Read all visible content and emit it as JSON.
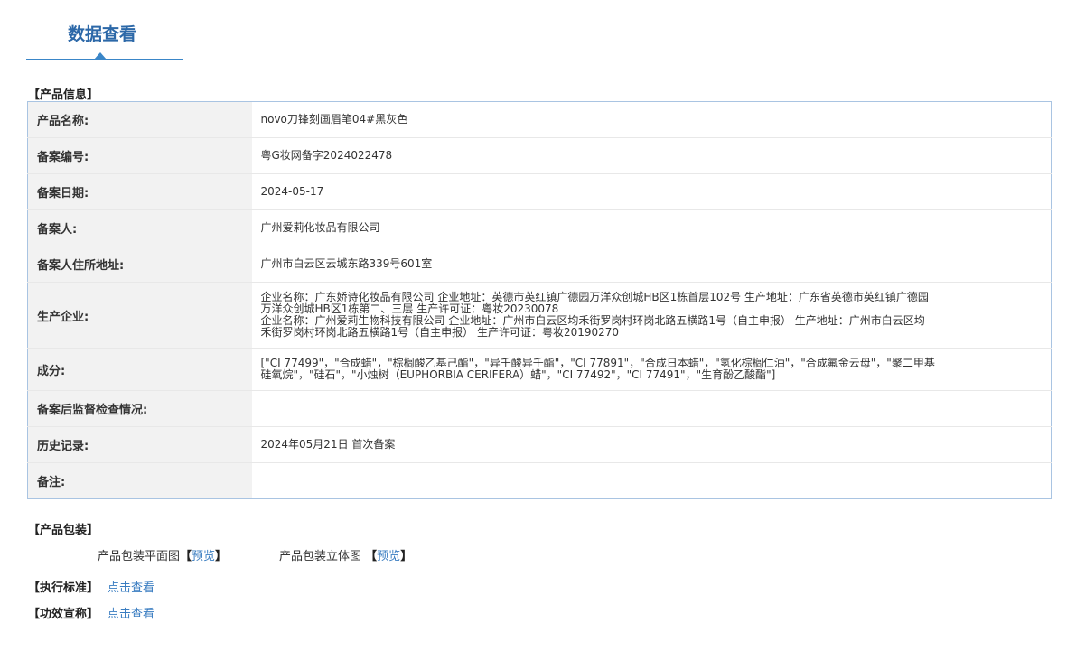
{
  "header": {
    "title": "数据查看"
  },
  "product_info": {
    "section_title": "【产品信息】",
    "rows": [
      {
        "label": "产品名称:",
        "value": "novo刀锋刻画眉笔04#黑灰色"
      },
      {
        "label": "备案编号:",
        "value": "粤G妆网备字2024022478"
      },
      {
        "label": "备案日期:",
        "value": "2024-05-17"
      },
      {
        "label": "备案人:",
        "value": "广州爱莉化妆品有限公司"
      },
      {
        "label": "备案人住所地址:",
        "value": "广州市白云区云城东路339号601室"
      },
      {
        "label": "生产企业:",
        "lines": [
          "企业名称：广东娇诗化妆品有限公司 企业地址：英德市英红镇广德园万洋众创城HB区1栋首层102号 生产地址：广东省英德市英红镇广德园",
          "万洋众创城HB区1栋第二、三层 生产许可证：粤妆20230078",
          "企业名称：广州爱莉生物科技有限公司 企业地址：广州市白云区均禾街罗岗村环岗北路五横路1号（自主申报） 生产地址：广州市白云区均",
          "禾街罗岗村环岗北路五横路1号（自主申报） 生产许可证：粤妆20190270"
        ]
      },
      {
        "label": "成分:",
        "lines": [
          "[\"CI 77499\"，\"合成蜡\"，\"棕榈酸乙基己酯\"，\"异壬酸异壬酯\"，\"CI 77891\"，\"合成日本蜡\"，\"氢化棕榈仁油\"，\"合成氟金云母\"，\"聚二甲基",
          "硅氧烷\"，\"硅石\"，\"小烛树（EUPHORBIA CERIFERA）蜡\"，\"CI 77492\"，\"CI 77491\"，\"生育酚乙酸酯\"]"
        ]
      },
      {
        "label": "备案后监督检查情况:",
        "value": ""
      },
      {
        "label": "历史记录:",
        "value": "2024年05月21日 首次备案"
      },
      {
        "label": "备注:",
        "value": ""
      }
    ]
  },
  "packaging": {
    "section_title": "【产品包装】",
    "flat_label": "产品包装平面图",
    "flat_link": "预览",
    "solid_label": "产品包装立体图",
    "solid_link": "预览",
    "bracket_open": "【",
    "bracket_close": "】"
  },
  "standard": {
    "label": "【执行标准】",
    "link": "点击查看"
  },
  "efficacy": {
    "label": "【功效宣称】",
    "link": "点击查看"
  }
}
